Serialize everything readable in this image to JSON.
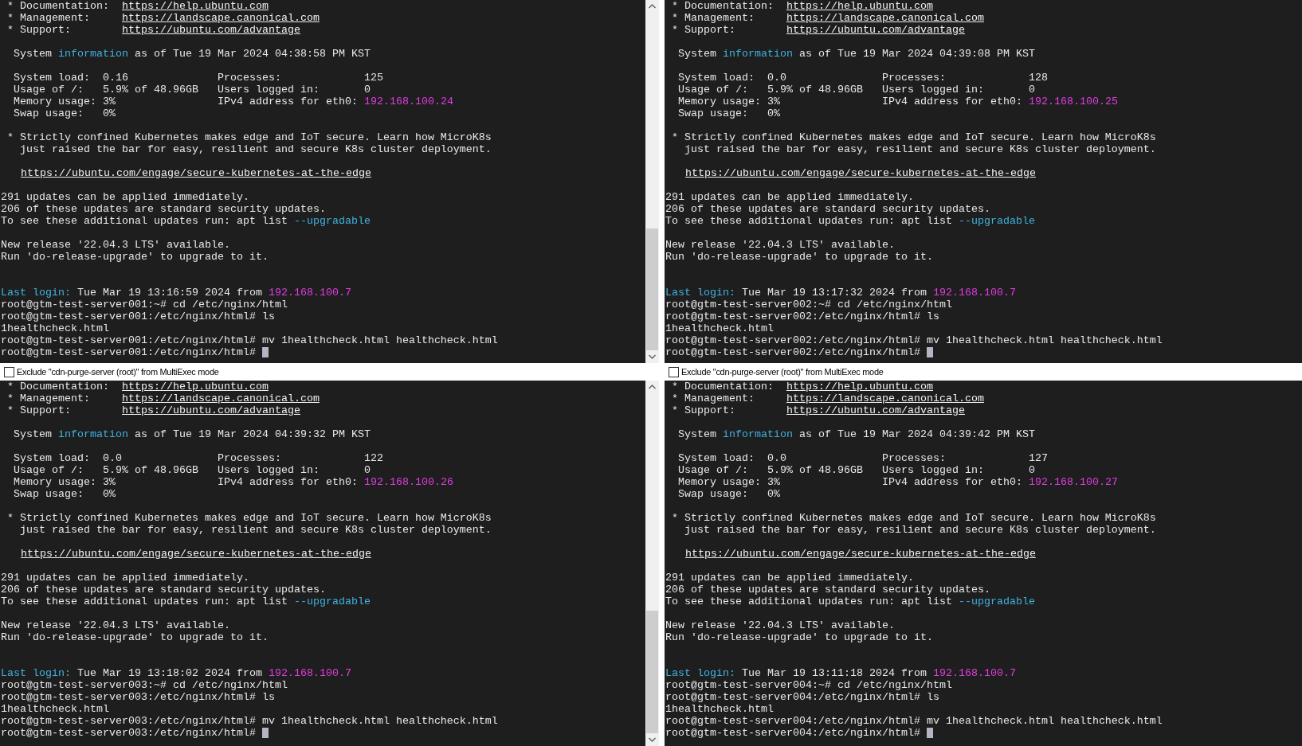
{
  "panes": [
    {
      "scrollbar": true,
      "exclude_checkbox": {
        "label": "Exclude \"cdn-purge-server (root)\" from MultiExec mode",
        "checked": false
      },
      "lines": [
        {
          "kind": "text",
          "spans": [
            {
              "text": " * Documentation:  ",
              "kind": "plain"
            },
            {
              "text": "https://help.ubuntu.com",
              "kind": "link"
            }
          ]
        },
        {
          "kind": "text",
          "spans": [
            {
              "text": " * Management:     ",
              "kind": "plain"
            },
            {
              "text": "https://landscape.canonical.com",
              "kind": "link"
            }
          ]
        },
        {
          "kind": "text",
          "spans": [
            {
              "text": " * Support:        ",
              "kind": "plain"
            },
            {
              "text": "https://ubuntu.com/advantage",
              "kind": "link"
            }
          ]
        },
        {
          "kind": "blank"
        },
        {
          "kind": "text",
          "spans": [
            {
              "text": "  System ",
              "kind": "plain"
            },
            {
              "text": "information",
              "kind": "cyan"
            },
            {
              "text": " as of Tue 19 Mar 2024 04:38:58 PM KST",
              "kind": "plain"
            }
          ]
        },
        {
          "kind": "blank"
        },
        {
          "kind": "text",
          "spans": [
            {
              "text": "  System load:  0.16              Processes:             125",
              "kind": "plain"
            }
          ]
        },
        {
          "kind": "text",
          "spans": [
            {
              "text": "  Usage of /:   5.9% of 48.96GB   Users logged in:       0",
              "kind": "plain"
            }
          ]
        },
        {
          "kind": "text",
          "spans": [
            {
              "text": "  Memory usage: 3%                IPv4 address for eth0: ",
              "kind": "plain"
            },
            {
              "text": "192.168.100.24",
              "kind": "magenta"
            }
          ]
        },
        {
          "kind": "text",
          "spans": [
            {
              "text": "  Swap usage:   0%",
              "kind": "plain"
            }
          ]
        },
        {
          "kind": "blank"
        },
        {
          "kind": "text",
          "spans": [
            {
              "text": " * Strictly confined Kubernetes makes edge and IoT secure. Learn how MicroK8s",
              "kind": "plain"
            }
          ]
        },
        {
          "kind": "text",
          "spans": [
            {
              "text": "   just raised the bar for easy, resilient and secure K8s cluster deployment.",
              "kind": "plain"
            }
          ]
        },
        {
          "kind": "blank"
        },
        {
          "kind": "indented",
          "spans": [
            {
              "text": "https://ubuntu.com/engage/secure-kubernetes-at-the-edge",
              "kind": "link"
            }
          ]
        },
        {
          "kind": "blank"
        },
        {
          "kind": "text",
          "spans": [
            {
              "text": "291 updates can be applied immediately.",
              "kind": "plain"
            }
          ]
        },
        {
          "kind": "text",
          "spans": [
            {
              "text": "206 of these updates are standard security updates.",
              "kind": "plain"
            }
          ]
        },
        {
          "kind": "text",
          "spans": [
            {
              "text": "To see these additional updates run: apt list ",
              "kind": "plain"
            },
            {
              "text": "--upgradable",
              "kind": "cyan"
            }
          ]
        },
        {
          "kind": "blank"
        },
        {
          "kind": "text",
          "spans": [
            {
              "text": "New release '22.04.3 LTS' available.",
              "kind": "plain"
            }
          ]
        },
        {
          "kind": "text",
          "spans": [
            {
              "text": "Run 'do-release-upgrade' to upgrade to it.",
              "kind": "plain"
            }
          ]
        },
        {
          "kind": "blank"
        },
        {
          "kind": "blank"
        },
        {
          "kind": "text",
          "spans": [
            {
              "text": "Last login:",
              "kind": "cyan"
            },
            {
              "text": " Tue Mar 19 13:16:59 2024 from ",
              "kind": "plain"
            },
            {
              "text": "192.168.100.7",
              "kind": "magenta"
            }
          ]
        },
        {
          "kind": "text",
          "spans": [
            {
              "text": "root@gtm-test-server001:~# cd /etc/nginx/html",
              "kind": "plain"
            }
          ]
        },
        {
          "kind": "text",
          "spans": [
            {
              "text": "root@gtm-test-server001:/etc/nginx/html# ls",
              "kind": "plain"
            }
          ]
        },
        {
          "kind": "text",
          "spans": [
            {
              "text": "1healthcheck.html",
              "kind": "plain"
            }
          ]
        },
        {
          "kind": "text",
          "spans": [
            {
              "text": "root@gtm-test-server001:/etc/nginx/html# mv 1healthcheck.html healthcheck.html",
              "kind": "plain"
            }
          ]
        },
        {
          "kind": "text",
          "cursor": true,
          "spans": [
            {
              "text": "root@gtm-test-server001:/etc/nginx/html# ",
              "kind": "plain"
            }
          ]
        }
      ]
    },
    {
      "scrollbar": false,
      "exclude_checkbox": {
        "label": "Exclude \"cdn-purge-server (root)\" from MultiExec mode",
        "checked": false
      },
      "lines": [
        {
          "kind": "text",
          "spans": [
            {
              "text": " * Documentation:  ",
              "kind": "plain"
            },
            {
              "text": "https://help.ubuntu.com",
              "kind": "link"
            }
          ]
        },
        {
          "kind": "text",
          "spans": [
            {
              "text": " * Management:     ",
              "kind": "plain"
            },
            {
              "text": "https://landscape.canonical.com",
              "kind": "link"
            }
          ]
        },
        {
          "kind": "text",
          "spans": [
            {
              "text": " * Support:        ",
              "kind": "plain"
            },
            {
              "text": "https://ubuntu.com/advantage",
              "kind": "link"
            }
          ]
        },
        {
          "kind": "blank"
        },
        {
          "kind": "text",
          "spans": [
            {
              "text": "  System ",
              "kind": "plain"
            },
            {
              "text": "information",
              "kind": "cyan"
            },
            {
              "text": " as of Tue 19 Mar 2024 04:39:08 PM KST",
              "kind": "plain"
            }
          ]
        },
        {
          "kind": "blank"
        },
        {
          "kind": "text",
          "spans": [
            {
              "text": "  System load:  0.0               Processes:             128",
              "kind": "plain"
            }
          ]
        },
        {
          "kind": "text",
          "spans": [
            {
              "text": "  Usage of /:   5.9% of 48.96GB   Users logged in:       0",
              "kind": "plain"
            }
          ]
        },
        {
          "kind": "text",
          "spans": [
            {
              "text": "  Memory usage: 3%                IPv4 address for eth0: ",
              "kind": "plain"
            },
            {
              "text": "192.168.100.25",
              "kind": "magenta"
            }
          ]
        },
        {
          "kind": "text",
          "spans": [
            {
              "text": "  Swap usage:   0%",
              "kind": "plain"
            }
          ]
        },
        {
          "kind": "blank"
        },
        {
          "kind": "text",
          "spans": [
            {
              "text": " * Strictly confined Kubernetes makes edge and IoT secure. Learn how MicroK8s",
              "kind": "plain"
            }
          ]
        },
        {
          "kind": "text",
          "spans": [
            {
              "text": "   just raised the bar for easy, resilient and secure K8s cluster deployment.",
              "kind": "plain"
            }
          ]
        },
        {
          "kind": "blank"
        },
        {
          "kind": "indented",
          "spans": [
            {
              "text": "https://ubuntu.com/engage/secure-kubernetes-at-the-edge",
              "kind": "link"
            }
          ]
        },
        {
          "kind": "blank"
        },
        {
          "kind": "text",
          "spans": [
            {
              "text": "291 updates can be applied immediately.",
              "kind": "plain"
            }
          ]
        },
        {
          "kind": "text",
          "spans": [
            {
              "text": "206 of these updates are standard security updates.",
              "kind": "plain"
            }
          ]
        },
        {
          "kind": "text",
          "spans": [
            {
              "text": "To see these additional updates run: apt list ",
              "kind": "plain"
            },
            {
              "text": "--upgradable",
              "kind": "cyan"
            }
          ]
        },
        {
          "kind": "blank"
        },
        {
          "kind": "text",
          "spans": [
            {
              "text": "New release '22.04.3 LTS' available.",
              "kind": "plain"
            }
          ]
        },
        {
          "kind": "text",
          "spans": [
            {
              "text": "Run 'do-release-upgrade' to upgrade to it.",
              "kind": "plain"
            }
          ]
        },
        {
          "kind": "blank"
        },
        {
          "kind": "blank"
        },
        {
          "kind": "text",
          "spans": [
            {
              "text": "Last login:",
              "kind": "cyan"
            },
            {
              "text": " Tue Mar 19 13:17:32 2024 from ",
              "kind": "plain"
            },
            {
              "text": "192.168.100.7",
              "kind": "magenta"
            }
          ]
        },
        {
          "kind": "text",
          "spans": [
            {
              "text": "root@gtm-test-server002:~# cd /etc/nginx/html",
              "kind": "plain"
            }
          ]
        },
        {
          "kind": "text",
          "spans": [
            {
              "text": "root@gtm-test-server002:/etc/nginx/html# ls",
              "kind": "plain"
            }
          ]
        },
        {
          "kind": "text",
          "spans": [
            {
              "text": "1healthcheck.html",
              "kind": "plain"
            }
          ]
        },
        {
          "kind": "text",
          "spans": [
            {
              "text": "root@gtm-test-server002:/etc/nginx/html# mv 1healthcheck.html healthcheck.html",
              "kind": "plain"
            }
          ]
        },
        {
          "kind": "text",
          "cursor": true,
          "spans": [
            {
              "text": "root@gtm-test-server002:/etc/nginx/html# ",
              "kind": "plain"
            }
          ]
        }
      ]
    },
    {
      "scrollbar": true,
      "lines": [
        {
          "kind": "text",
          "spans": [
            {
              "text": " * Documentation:  ",
              "kind": "plain"
            },
            {
              "text": "https://help.ubuntu.com",
              "kind": "link"
            }
          ]
        },
        {
          "kind": "text",
          "spans": [
            {
              "text": " * Management:     ",
              "kind": "plain"
            },
            {
              "text": "https://landscape.canonical.com",
              "kind": "link"
            }
          ]
        },
        {
          "kind": "text",
          "spans": [
            {
              "text": " * Support:        ",
              "kind": "plain"
            },
            {
              "text": "https://ubuntu.com/advantage",
              "kind": "link"
            }
          ]
        },
        {
          "kind": "blank"
        },
        {
          "kind": "text",
          "spans": [
            {
              "text": "  System ",
              "kind": "plain"
            },
            {
              "text": "information",
              "kind": "cyan"
            },
            {
              "text": " as of Tue 19 Mar 2024 04:39:32 PM KST",
              "kind": "plain"
            }
          ]
        },
        {
          "kind": "blank"
        },
        {
          "kind": "text",
          "spans": [
            {
              "text": "  System load:  0.0               Processes:             122",
              "kind": "plain"
            }
          ]
        },
        {
          "kind": "text",
          "spans": [
            {
              "text": "  Usage of /:   5.9% of 48.96GB   Users logged in:       0",
              "kind": "plain"
            }
          ]
        },
        {
          "kind": "text",
          "spans": [
            {
              "text": "  Memory usage: 3%                IPv4 address for eth0: ",
              "kind": "plain"
            },
            {
              "text": "192.168.100.26",
              "kind": "magenta"
            }
          ]
        },
        {
          "kind": "text",
          "spans": [
            {
              "text": "  Swap usage:   0%",
              "kind": "plain"
            }
          ]
        },
        {
          "kind": "blank"
        },
        {
          "kind": "text",
          "spans": [
            {
              "text": " * Strictly confined Kubernetes makes edge and IoT secure. Learn how MicroK8s",
              "kind": "plain"
            }
          ]
        },
        {
          "kind": "text",
          "spans": [
            {
              "text": "   just raised the bar for easy, resilient and secure K8s cluster deployment.",
              "kind": "plain"
            }
          ]
        },
        {
          "kind": "blank"
        },
        {
          "kind": "indented",
          "spans": [
            {
              "text": "https://ubuntu.com/engage/secure-kubernetes-at-the-edge",
              "kind": "link"
            }
          ]
        },
        {
          "kind": "blank"
        },
        {
          "kind": "text",
          "spans": [
            {
              "text": "291 updates can be applied immediately.",
              "kind": "plain"
            }
          ]
        },
        {
          "kind": "text",
          "spans": [
            {
              "text": "206 of these updates are standard security updates.",
              "kind": "plain"
            }
          ]
        },
        {
          "kind": "text",
          "spans": [
            {
              "text": "To see these additional updates run: apt list ",
              "kind": "plain"
            },
            {
              "text": "--upgradable",
              "kind": "cyan"
            }
          ]
        },
        {
          "kind": "blank"
        },
        {
          "kind": "text",
          "spans": [
            {
              "text": "New release '22.04.3 LTS' available.",
              "kind": "plain"
            }
          ]
        },
        {
          "kind": "text",
          "spans": [
            {
              "text": "Run 'do-release-upgrade' to upgrade to it.",
              "kind": "plain"
            }
          ]
        },
        {
          "kind": "blank"
        },
        {
          "kind": "blank"
        },
        {
          "kind": "text",
          "spans": [
            {
              "text": "Last login:",
              "kind": "cyan"
            },
            {
              "text": " Tue Mar 19 13:18:02 2024 from ",
              "kind": "plain"
            },
            {
              "text": "192.168.100.7",
              "kind": "magenta"
            }
          ]
        },
        {
          "kind": "text",
          "spans": [
            {
              "text": "root@gtm-test-server003:~# cd /etc/nginx/html",
              "kind": "plain"
            }
          ]
        },
        {
          "kind": "text",
          "spans": [
            {
              "text": "root@gtm-test-server003:/etc/nginx/html# ls",
              "kind": "plain"
            }
          ]
        },
        {
          "kind": "text",
          "spans": [
            {
              "text": "1healthcheck.html",
              "kind": "plain"
            }
          ]
        },
        {
          "kind": "text",
          "spans": [
            {
              "text": "root@gtm-test-server003:/etc/nginx/html# mv 1healthcheck.html healthcheck.html",
              "kind": "plain"
            }
          ]
        },
        {
          "kind": "text",
          "cursor": true,
          "spans": [
            {
              "text": "root@gtm-test-server003:/etc/nginx/html# ",
              "kind": "plain"
            }
          ]
        }
      ]
    },
    {
      "scrollbar": false,
      "lines": [
        {
          "kind": "text",
          "spans": [
            {
              "text": " * Documentation:  ",
              "kind": "plain"
            },
            {
              "text": "https://help.ubuntu.com",
              "kind": "link"
            }
          ]
        },
        {
          "kind": "text",
          "spans": [
            {
              "text": " * Management:     ",
              "kind": "plain"
            },
            {
              "text": "https://landscape.canonical.com",
              "kind": "link"
            }
          ]
        },
        {
          "kind": "text",
          "spans": [
            {
              "text": " * Support:        ",
              "kind": "plain"
            },
            {
              "text": "https://ubuntu.com/advantage",
              "kind": "link"
            }
          ]
        },
        {
          "kind": "blank"
        },
        {
          "kind": "text",
          "spans": [
            {
              "text": "  System ",
              "kind": "plain"
            },
            {
              "text": "information",
              "kind": "cyan"
            },
            {
              "text": " as of Tue 19 Mar 2024 04:39:42 PM KST",
              "kind": "plain"
            }
          ]
        },
        {
          "kind": "blank"
        },
        {
          "kind": "text",
          "spans": [
            {
              "text": "  System load:  0.0               Processes:             127",
              "kind": "plain"
            }
          ]
        },
        {
          "kind": "text",
          "spans": [
            {
              "text": "  Usage of /:   5.9% of 48.96GB   Users logged in:       0",
              "kind": "plain"
            }
          ]
        },
        {
          "kind": "text",
          "spans": [
            {
              "text": "  Memory usage: 3%                IPv4 address for eth0: ",
              "kind": "plain"
            },
            {
              "text": "192.168.100.27",
              "kind": "magenta"
            }
          ]
        },
        {
          "kind": "text",
          "spans": [
            {
              "text": "  Swap usage:   0%",
              "kind": "plain"
            }
          ]
        },
        {
          "kind": "blank"
        },
        {
          "kind": "text",
          "spans": [
            {
              "text": " * Strictly confined Kubernetes makes edge and IoT secure. Learn how MicroK8s",
              "kind": "plain"
            }
          ]
        },
        {
          "kind": "text",
          "spans": [
            {
              "text": "   just raised the bar for easy, resilient and secure K8s cluster deployment.",
              "kind": "plain"
            }
          ]
        },
        {
          "kind": "blank"
        },
        {
          "kind": "indented",
          "spans": [
            {
              "text": "https://ubuntu.com/engage/secure-kubernetes-at-the-edge",
              "kind": "link"
            }
          ]
        },
        {
          "kind": "blank"
        },
        {
          "kind": "text",
          "spans": [
            {
              "text": "291 updates can be applied immediately.",
              "kind": "plain"
            }
          ]
        },
        {
          "kind": "text",
          "spans": [
            {
              "text": "206 of these updates are standard security updates.",
              "kind": "plain"
            }
          ]
        },
        {
          "kind": "text",
          "spans": [
            {
              "text": "To see these additional updates run: apt list ",
              "kind": "plain"
            },
            {
              "text": "--upgradable",
              "kind": "cyan"
            }
          ]
        },
        {
          "kind": "blank"
        },
        {
          "kind": "text",
          "spans": [
            {
              "text": "New release '22.04.3 LTS' available.",
              "kind": "plain"
            }
          ]
        },
        {
          "kind": "text",
          "spans": [
            {
              "text": "Run 'do-release-upgrade' to upgrade to it.",
              "kind": "plain"
            }
          ]
        },
        {
          "kind": "blank"
        },
        {
          "kind": "blank"
        },
        {
          "kind": "text",
          "spans": [
            {
              "text": "Last login:",
              "kind": "cyan"
            },
            {
              "text": " Tue Mar 19 13:11:18 2024 from ",
              "kind": "plain"
            },
            {
              "text": "192.168.100.7",
              "kind": "magenta"
            }
          ]
        },
        {
          "kind": "text",
          "spans": [
            {
              "text": "root@gtm-test-server004:~# cd /etc/nginx/html",
              "kind": "plain"
            }
          ]
        },
        {
          "kind": "text",
          "spans": [
            {
              "text": "root@gtm-test-server004:/etc/nginx/html# ls",
              "kind": "plain"
            }
          ]
        },
        {
          "kind": "text",
          "spans": [
            {
              "text": "1healthcheck.html",
              "kind": "plain"
            }
          ]
        },
        {
          "kind": "text",
          "spans": [
            {
              "text": "root@gtm-test-server004:/etc/nginx/html# mv 1healthcheck.html healthcheck.html",
              "kind": "plain"
            }
          ]
        },
        {
          "kind": "text",
          "cursor": true,
          "spans": [
            {
              "text": "root@gtm-test-server004:/etc/nginx/html# ",
              "kind": "plain"
            }
          ]
        }
      ]
    }
  ]
}
